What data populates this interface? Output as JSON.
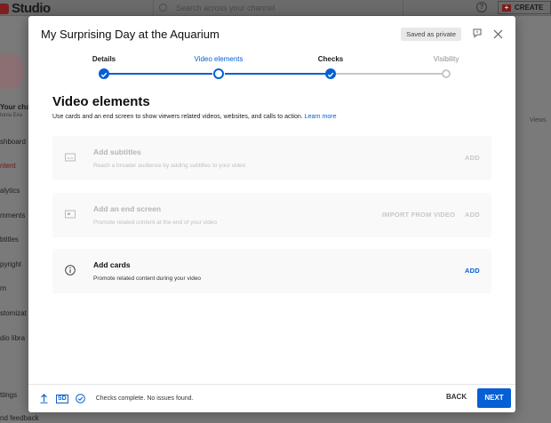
{
  "studio_bg": {
    "logo_text": "Studio",
    "search_placeholder": "Search across your channel",
    "help_glyph": "?",
    "create_label": "CREATE",
    "channel_title": "Your cha",
    "channel_subtitle": "tonia Exa",
    "nav": [
      "shboard",
      "ntent",
      "alytics",
      "mments",
      "btitles",
      "pyright",
      "rn",
      "stomizat",
      "dio libra",
      "ttings",
      "nd feedback"
    ],
    "active_nav_index": 1,
    "views_label": "Views"
  },
  "modal": {
    "title": "My Surprising Day at the Aquarium",
    "saved_badge": "Saved as private",
    "icons": {
      "feedback": "feedback-flag-icon",
      "close": "close-icon"
    },
    "steps": [
      {
        "label": "Details",
        "state": "done"
      },
      {
        "label": "Video elements",
        "state": "current"
      },
      {
        "label": "Checks",
        "state": "done"
      },
      {
        "label": "Visibility",
        "state": "pending"
      }
    ],
    "section": {
      "title": "Video elements",
      "description": "Use cards and an end screen to show viewers related videos, websites, and calls to action.",
      "learn_more": "Learn more"
    },
    "cards": [
      {
        "title": "Add subtitles",
        "description": "Reach a broader audience by adding subtitles to your video",
        "icon": "subtitles-icon",
        "actions": [
          "ADD"
        ],
        "enabled": false
      },
      {
        "title": "Add an end screen",
        "description": "Promote related content at the end of your video",
        "icon": "end-screen-icon",
        "actions": [
          "IMPORT FROM VIDEO",
          "ADD"
        ],
        "enabled": false
      },
      {
        "title": "Add cards",
        "description": "Promote related content during your video",
        "icon": "info-icon",
        "actions": [
          "ADD"
        ],
        "enabled": true
      }
    ],
    "footer": {
      "sd_badge": "SD",
      "status": "Checks complete. No issues found.",
      "back": "BACK",
      "next": "NEXT"
    }
  },
  "colors": {
    "accent": "#065fd4",
    "overlay": "#7a7a7a",
    "card_bg": "#f9f9f9"
  }
}
